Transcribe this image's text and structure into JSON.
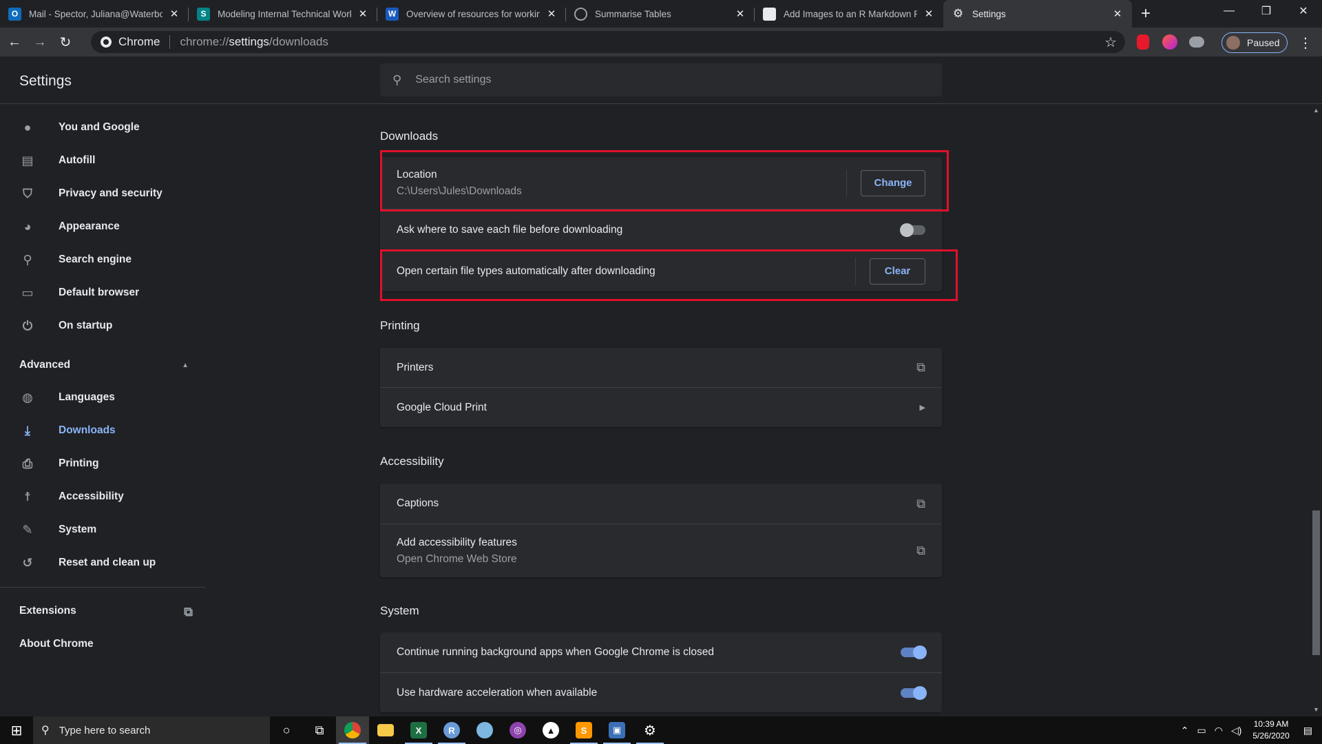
{
  "tabs": [
    {
      "title": "Mail - Spector, Juliana@Waterboards",
      "favicon": "outlook-icon",
      "color": "#0f6cbd",
      "glyph": "O"
    },
    {
      "title": "Modeling Internal Technical Working",
      "favicon": "sharepoint-icon",
      "color": "#038387",
      "glyph": "S"
    },
    {
      "title": "Overview of resources for working wi",
      "favicon": "word-icon",
      "color": "#185abd",
      "glyph": "W"
    },
    {
      "title": "Summarise Tables",
      "favicon": "globe-icon",
      "color": "#5f6368",
      "glyph": ""
    },
    {
      "title": "Add Images to an R Markdown Repo",
      "favicon": "image-icon",
      "color": "#3c4043",
      "glyph": ""
    },
    {
      "title": "Settings",
      "favicon": "gear-icon",
      "color": "",
      "glyph": "⚙"
    }
  ],
  "toolbar": {
    "site_label": "Chrome",
    "url_prefix": "chrome://",
    "url_host": "settings",
    "url_path": "/downloads",
    "profile_label": "Paused"
  },
  "header": {
    "title": "Settings",
    "search_placeholder": "Search settings"
  },
  "sidebar": {
    "items": [
      {
        "label": "You and Google",
        "icon": "person-icon"
      },
      {
        "label": "Autofill",
        "icon": "clipboard-icon"
      },
      {
        "label": "Privacy and security",
        "icon": "shield-icon"
      },
      {
        "label": "Appearance",
        "icon": "palette-icon"
      },
      {
        "label": "Search engine",
        "icon": "search-icon"
      },
      {
        "label": "Default browser",
        "icon": "browser-icon"
      },
      {
        "label": "On startup",
        "icon": "power-icon"
      }
    ],
    "advanced_label": "Advanced",
    "advanced_items": [
      {
        "label": "Languages",
        "icon": "globe-icon"
      },
      {
        "label": "Downloads",
        "icon": "download-icon"
      },
      {
        "label": "Printing",
        "icon": "printer-icon"
      },
      {
        "label": "Accessibility",
        "icon": "accessibility-icon"
      },
      {
        "label": "System",
        "icon": "wrench-icon"
      },
      {
        "label": "Reset and clean up",
        "icon": "history-icon"
      }
    ],
    "extensions_label": "Extensions",
    "about_label": "About Chrome"
  },
  "downloads": {
    "title": "Downloads",
    "location_label": "Location",
    "location_value": "C:\\Users\\Jules\\Downloads",
    "change_button": "Change",
    "ask_label": "Ask where to save each file before downloading",
    "ask_enabled": false,
    "auto_open_label": "Open certain file types automatically after downloading",
    "clear_button": "Clear"
  },
  "printing": {
    "title": "Printing",
    "printers_label": "Printers",
    "cloud_print_label": "Google Cloud Print"
  },
  "accessibility": {
    "title": "Accessibility",
    "captions_label": "Captions",
    "add_features_label": "Add accessibility features",
    "add_features_sub": "Open Chrome Web Store"
  },
  "system": {
    "title": "System",
    "background_label": "Continue running background apps when Google Chrome is closed",
    "background_enabled": true,
    "hw_accel_label": "Use hardware acceleration when available",
    "hw_accel_enabled": true
  },
  "taskbar": {
    "search_placeholder": "Type here to search",
    "time": "10:39 AM",
    "date": "5/26/2020"
  },
  "colors": {
    "highlight": "#e0102b",
    "accent": "#8ab4f8"
  }
}
